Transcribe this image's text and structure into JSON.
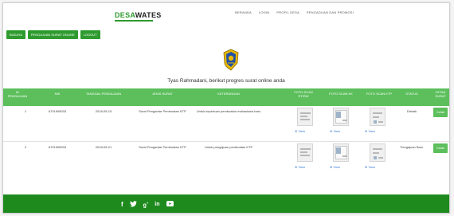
{
  "brand": {
    "part1": "DESA",
    "part2": "WATES"
  },
  "topnav": [
    "BERANDA",
    "LOGIN",
    "PROFIL DESA",
    "PENGADUAN DAN PROMOSI"
  ],
  "buttons": [
    "BUDAYA",
    "PENGAJUAN SURAT ONLINE",
    "LOGOUT"
  ],
  "greeting": "Tyas Rahmadani, berikut progres surat online anda",
  "table": {
    "headers": [
      "ID PENGAJUAN",
      "NIK",
      "TANGGAL PENGAJUAN",
      "JENIS SURAT",
      "KETERANGAN",
      "FOTO SCAN RT/RW",
      "FOTO SCAN KK",
      "FOTO SCAN KTP",
      "STATUS",
      "CETAK SURAT"
    ],
    "view_label": "View",
    "cetak_label": "Cetak",
    "rows": [
      {
        "id": "1",
        "nik": "6701908033",
        "date": "2018-05-15",
        "jenis": "Surat Pengantar Pembuatan KTP",
        "ket": "Untuk keperluan pembuatan mahasiswa baru",
        "status": "Ditolak"
      },
      {
        "id": "2",
        "nik": "6701908033",
        "date": "2018-05-21",
        "jenis": "Surat Pengantar Pembuatan KTP",
        "ket": "Untuk pengajuan pembuatan KTP",
        "status": "Pengajuan Baru"
      }
    ]
  },
  "footer": {
    "icons": [
      "facebook-icon",
      "twitter-icon",
      "google-plus-icon",
      "linkedin-icon",
      "youtube-icon"
    ]
  },
  "colors": {
    "primary_green": "#2f9b2f",
    "header_green": "#5cbf5c",
    "footer_green": "#1e8a1e",
    "link_blue": "#3a7bd5"
  }
}
